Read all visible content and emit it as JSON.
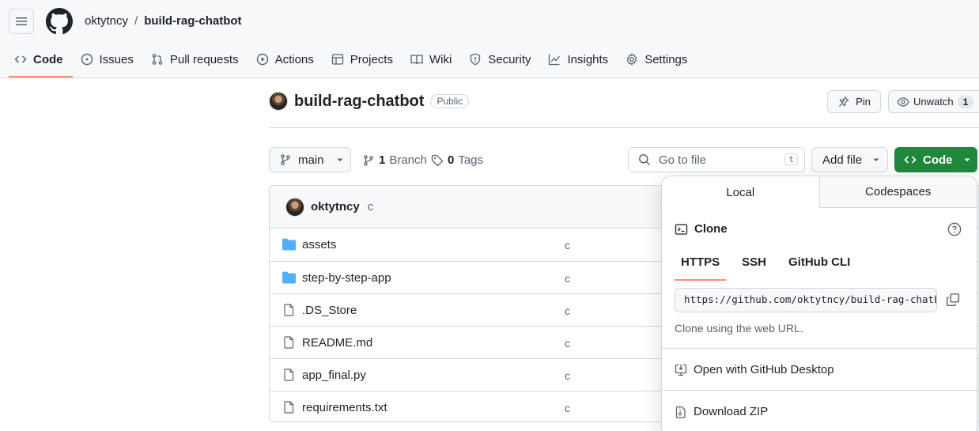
{
  "header": {
    "owner": "oktytncy",
    "separator": "/",
    "repo": "build-rag-chatbot"
  },
  "nav_tabs": [
    {
      "label": "Code",
      "icon": "code-icon"
    },
    {
      "label": "Issues",
      "icon": "issue-icon"
    },
    {
      "label": "Pull requests",
      "icon": "pull-request-icon"
    },
    {
      "label": "Actions",
      "icon": "play-icon"
    },
    {
      "label": "Projects",
      "icon": "table-icon"
    },
    {
      "label": "Wiki",
      "icon": "book-icon"
    },
    {
      "label": "Security",
      "icon": "shield-icon"
    },
    {
      "label": "Insights",
      "icon": "graph-icon"
    },
    {
      "label": "Settings",
      "icon": "gear-icon"
    }
  ],
  "repo": {
    "name": "build-rag-chatbot",
    "visibility": "Public",
    "pin_label": "Pin",
    "unwatch_label": "Unwatch",
    "watch_count": "1"
  },
  "toolbar": {
    "branch": "main",
    "branch_count": "1",
    "branch_label": "Branch",
    "tag_count": "0",
    "tag_label": "Tags",
    "goto_placeholder": "Go to file",
    "goto_shortcut": "t",
    "add_file_label": "Add file",
    "code_label": "Code"
  },
  "latest_commit": {
    "author": "oktytncy",
    "message": "c"
  },
  "files": [
    {
      "name": "assets",
      "type": "folder",
      "message": "c"
    },
    {
      "name": "step-by-step-app",
      "type": "folder",
      "message": "c"
    },
    {
      "name": ".DS_Store",
      "type": "file",
      "message": "c"
    },
    {
      "name": "README.md",
      "type": "file",
      "message": "c"
    },
    {
      "name": "app_final.py",
      "type": "file",
      "message": "c"
    },
    {
      "name": "requirements.txt",
      "type": "file",
      "message": "c"
    }
  ],
  "clone_panel": {
    "tab_local": "Local",
    "tab_codespaces": "Codespaces",
    "title": "Clone",
    "protocols": [
      "HTTPS",
      "SSH",
      "GitHub CLI"
    ],
    "url": "https://github.com/oktytncy/build-rag-chatbot.git",
    "hint": "Clone using the web URL.",
    "open_desktop": "Open with GitHub Desktop",
    "download_zip": "Download ZIP"
  },
  "colors": {
    "accent_underline": "#fd8c73",
    "code_button": "#1f883d",
    "folder": "#54aeff",
    "border": "#d1d9e0"
  }
}
